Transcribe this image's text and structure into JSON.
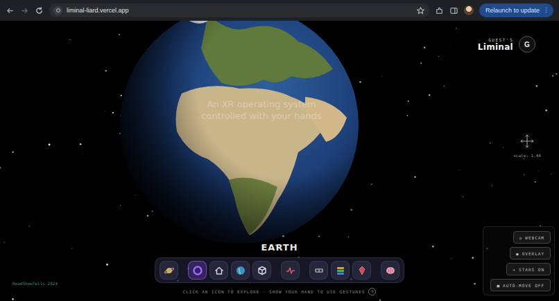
{
  "browser": {
    "url": "liminal-liard.vercel.app",
    "update_button": "Relaunch to update",
    "menu": "⋮"
  },
  "brand": {
    "owner": "GUEST'S",
    "name": "Liminal",
    "avatar": "G"
  },
  "scale": "scale: 1.44",
  "hero": {
    "lines": [
      "An XR operating system",
      "controlled with your hands"
    ]
  },
  "planet": {
    "label": "EARTH"
  },
  "dock": {
    "items": [
      {
        "selected": false
      },
      {
        "selected": true
      },
      {
        "selected": false
      },
      {
        "selected": false
      },
      {
        "selected": false
      },
      {
        "selected": false
      },
      {
        "selected": false
      },
      {
        "selected": false
      },
      {
        "selected": false
      },
      {
        "selected": false
      }
    ]
  },
  "hint": {
    "text": "CLICK AN ICON TO EXPLORE · SHOW YOUR HAND TO USE GESTURES",
    "help": "?"
  },
  "credit": "RoadShowTells 2024",
  "controls": [
    {
      "icon": "◎",
      "label": "WEBCAM"
    },
    {
      "icon": "●",
      "label": "OVERLAY"
    },
    {
      "icon": "✈",
      "label": "STARS ON"
    },
    {
      "icon": "■",
      "label": "AUTO-MOVE OFF"
    }
  ]
}
